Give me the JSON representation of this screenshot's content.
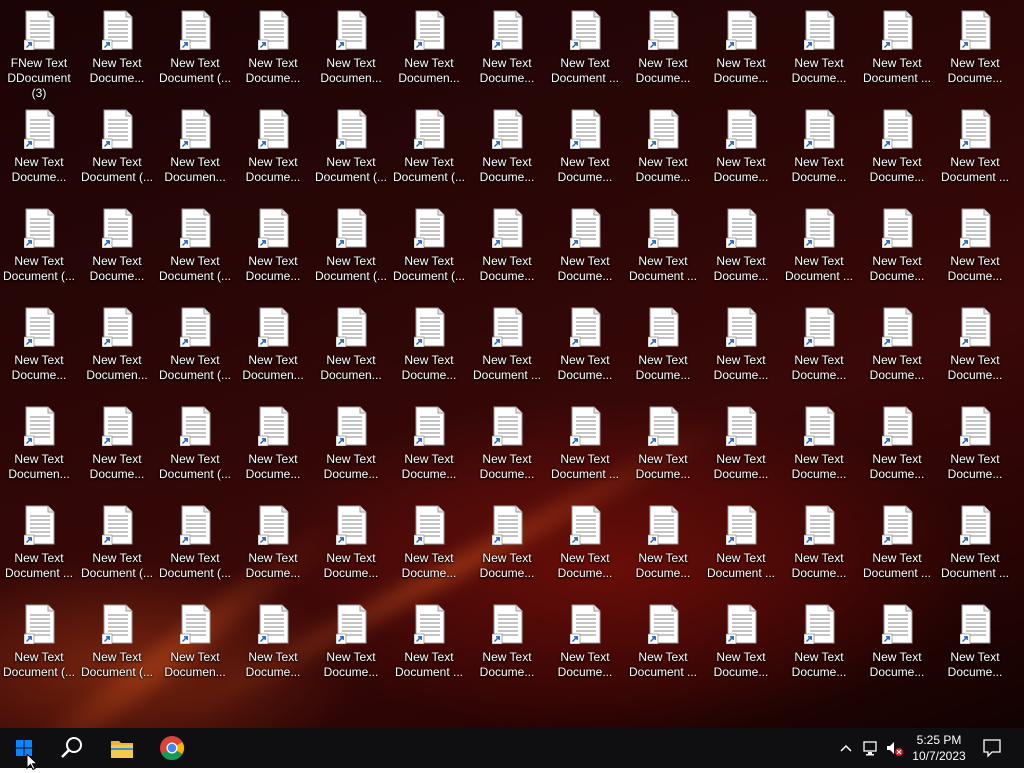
{
  "desktop": {
    "icons": [
      "FNew Text\nDDocument (3)",
      "New Text\nDocume...",
      "New Text\nDocument (...",
      "New Text\nDocume...",
      "New Text\nDocumen...",
      "New Text\nDocumen...",
      "New Text\nDocume...",
      "New Text\nDocument ...",
      "New Text\nDocume...",
      "New Text\nDocume...",
      "New Text\nDocume...",
      "New Text\nDocument ...",
      "New Text\nDocume...",
      "New Text\nDocume...",
      "New Text\nDocument (...",
      "New Text\nDocumen...",
      "New Text\nDocume...",
      "New Text\nDocument (...",
      "New Text\nDocument (...",
      "New Text\nDocume...",
      "New Text\nDocume...",
      "New Text\nDocume...",
      "New Text\nDocume...",
      "New Text\nDocume...",
      "New Text\nDocume...",
      "New Text\nDocument ...",
      "New Text\nDocument (...",
      "New Text\nDocume...",
      "New Text\nDocument (...",
      "New Text\nDocume...",
      "New Text\nDocument (...",
      "New Text\nDocument (...",
      "New Text\nDocume...",
      "New Text\nDocume...",
      "New Text\nDocument ...",
      "New Text\nDocume...",
      "New Text\nDocument ...",
      "New Text\nDocume...",
      "New Text\nDocume...",
      "New Text\nDocume...",
      "New Text\nDocumen...",
      "New Text\nDocument (...",
      "New Text\nDocumen...",
      "New Text\nDocumen...",
      "New Text\nDocume...",
      "New Text\nDocument ...",
      "New Text\nDocume...",
      "New Text\nDocume...",
      "New Text\nDocume...",
      "New Text\nDocume...",
      "New Text\nDocume...",
      "New Text\nDocume...",
      "New Text\nDocumen...",
      "New Text\nDocume...",
      "New Text\nDocument (...",
      "New Text\nDocume...",
      "New Text\nDocume...",
      "New Text\nDocume...",
      "New Text\nDocume...",
      "New Text\nDocument ...",
      "New Text\nDocume...",
      "New Text\nDocume...",
      "New Text\nDocume...",
      "New Text\nDocume...",
      "New Text\nDocume...",
      "New Text\nDocument ...",
      "New Text\nDocument (...",
      "New Text\nDocument (...",
      "New Text\nDocume...",
      "New Text\nDocume...",
      "New Text\nDocume...",
      "New Text\nDocume...",
      "New Text\nDocume...",
      "New Text\nDocume...",
      "New Text\nDocument ...",
      "New Text\nDocume...",
      "New Text\nDocument ...",
      "New Text\nDocument ...",
      "New Text\nDocument (...",
      "New Text\nDocument (...",
      "New Text\nDocumen...",
      "New Text\nDocume...",
      "New Text\nDocume...",
      "New Text\nDocument ...",
      "New Text\nDocume...",
      "New Text\nDocume...",
      "New Text\nDocument ...",
      "New Text\nDocume...",
      "New Text\nDocume...",
      "New Text\nDocume...",
      "New Text\nDocume..."
    ]
  },
  "taskbar": {
    "buttons": [
      "windows-start",
      "search",
      "file-explorer",
      "chrome"
    ],
    "tray_icons": [
      "chevron-up-icon",
      "network-icon",
      "volume-muted-icon"
    ],
    "time": "5:25 PM",
    "date": "10/7/2023",
    "notification_icon": "notification-icon",
    "accent_color": "#0078d7"
  }
}
